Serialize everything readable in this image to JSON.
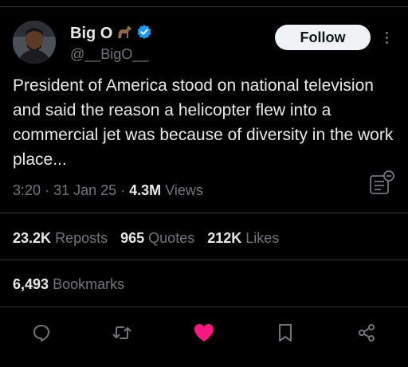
{
  "author": {
    "display_name": "Big O",
    "handle": "@__BigO__",
    "verified_icon": "verified-badge-icon",
    "emoji_icon": "horse-icon"
  },
  "follow_label": "Follow",
  "tweet": {
    "text": "President of America stood on national television and said the reason a helicopter flew into a commercial jet was because of diversity in the work place...",
    "time": "3:20",
    "date": "31 Jan 25",
    "views_count": "4.3M",
    "views_label": "Views"
  },
  "stats": {
    "reposts": {
      "count": "23.2K",
      "label": "Reposts"
    },
    "quotes": {
      "count": "965",
      "label": "Quotes"
    },
    "likes": {
      "count": "212K",
      "label": "Likes"
    },
    "bookmarks": {
      "count": "6,493",
      "label": "Bookmarks"
    }
  },
  "actions": [
    "reply-icon",
    "repost-icon",
    "like-icon",
    "bookmark-icon",
    "share-icon"
  ],
  "colors": {
    "background": "#000000",
    "text": "#e7e9ea",
    "muted": "#71767b",
    "divider": "#2f3336",
    "verified": "#1d9bf0",
    "like": "#f91880",
    "follow_bg": "#eff3f4"
  }
}
